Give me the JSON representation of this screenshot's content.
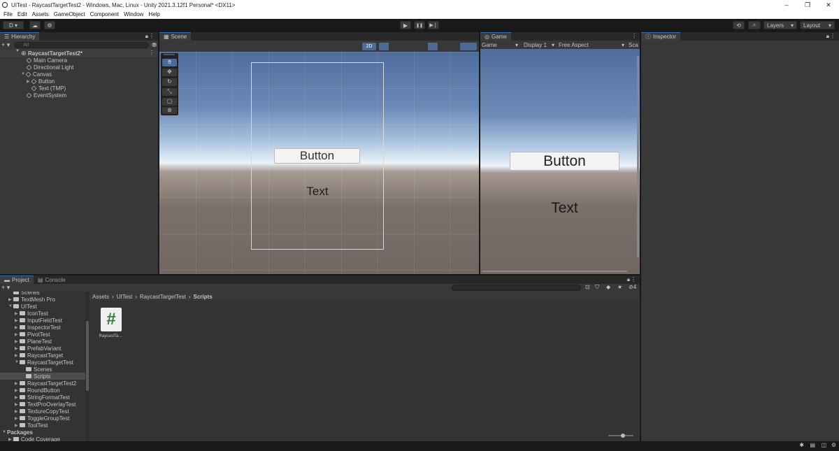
{
  "window": {
    "title": "UITest - RaycastTargetTest2 - Windows, Mac, Linux - Unity 2021.3.12f1 Personal* <DX11>",
    "minimize": "–",
    "maximize": "❐",
    "close": "✕"
  },
  "menu": [
    "File",
    "Edit",
    "Assets",
    "GameObject",
    "Component",
    "Window",
    "Help"
  ],
  "toolbar": {
    "account": "D ▾",
    "play": "▶",
    "pause": "❚❚",
    "step": "▶❘",
    "layers": "Layers",
    "layout": "Layout"
  },
  "hierarchy": {
    "tab": "Hierarchy",
    "search_placeholder": "All",
    "add": "+ ▾",
    "scene": "RaycastTargetTest2*",
    "items": [
      "Main Camera",
      "Directional Light",
      "Canvas",
      "Button",
      "Text (TMP)",
      "EventSystem"
    ]
  },
  "scene": {
    "tab": "Scene",
    "mode_2d": "2D",
    "button_label": "Button",
    "text_label": "Text"
  },
  "game": {
    "tab": "Game",
    "view": "Game",
    "display": "Display 1",
    "aspect": "Free Aspect",
    "scale": "Sca",
    "button_label": "Button",
    "text_label": "Text"
  },
  "inspector": {
    "tab": "Inspector"
  },
  "project": {
    "tab": "Project",
    "console_tab": "Console",
    "add": "+ ▾",
    "hidden_count": "4",
    "breadcrumb": [
      "Assets",
      "UITest",
      "RaycastTargetTest",
      "Scripts"
    ],
    "tree": [
      {
        "label": "Scenes",
        "indent": 1,
        "arrow": ""
      },
      {
        "label": "TextMesh Pro",
        "indent": 1,
        "arrow": "▶"
      },
      {
        "label": "UITest",
        "indent": 1,
        "arrow": "▼"
      },
      {
        "label": "IconTest",
        "indent": 2,
        "arrow": "▶"
      },
      {
        "label": "InputFieldTest",
        "indent": 2,
        "arrow": "▶"
      },
      {
        "label": "InspectorTest",
        "indent": 2,
        "arrow": "▶"
      },
      {
        "label": "PivotTest",
        "indent": 2,
        "arrow": "▶"
      },
      {
        "label": "PlaneTest",
        "indent": 2,
        "arrow": "▶"
      },
      {
        "label": "PrefabVariant",
        "indent": 2,
        "arrow": "▶"
      },
      {
        "label": "RaycastTarget",
        "indent": 2,
        "arrow": "▶"
      },
      {
        "label": "RaycastTargetTest",
        "indent": 2,
        "arrow": "▼"
      },
      {
        "label": "Scenes",
        "indent": 3,
        "arrow": ""
      },
      {
        "label": "Scripts",
        "indent": 3,
        "arrow": ""
      },
      {
        "label": "RaycastTargetTest2",
        "indent": 2,
        "arrow": "▶"
      },
      {
        "label": "RoundButton",
        "indent": 2,
        "arrow": "▶"
      },
      {
        "label": "StringFormatTest",
        "indent": 2,
        "arrow": "▶"
      },
      {
        "label": "TextProOverlayTest",
        "indent": 2,
        "arrow": "▶"
      },
      {
        "label": "TextureCopyTest",
        "indent": 2,
        "arrow": "▶"
      },
      {
        "label": "ToggleGroupTest",
        "indent": 2,
        "arrow": "▶"
      },
      {
        "label": "ToolTest",
        "indent": 2,
        "arrow": "▶"
      },
      {
        "label": "Packages",
        "indent": 0,
        "arrow": "▼"
      },
      {
        "label": "Code Coverage",
        "indent": 1,
        "arrow": "▶"
      }
    ],
    "file": {
      "name": "RaycastTa...",
      "glyph": "#"
    }
  },
  "colors": {
    "accent": "#2d6fb5",
    "selection": "#4d4d4d",
    "panel": "#383838",
    "script_icon": "#2e7d3a"
  }
}
